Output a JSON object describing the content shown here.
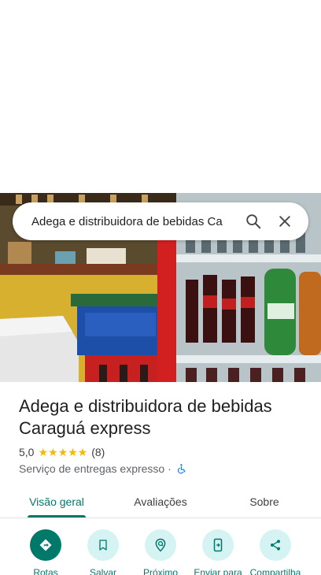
{
  "search": {
    "query": "Adega e distribuidora de bebidas Ca",
    "search_icon": "search-icon",
    "close_icon": "close-icon"
  },
  "place": {
    "name": "Adega e distribuidora de bebidas Caraguá express",
    "rating": "5,0",
    "stars": "★★★★★",
    "reviews_count": "(8)",
    "category": "Serviço de entregas expresso ·",
    "accessibility_icon": "wheelchair-icon"
  },
  "tabs": [
    {
      "label": "Visão geral",
      "active": true
    },
    {
      "label": "Avaliações",
      "active": false
    },
    {
      "label": "Sobre",
      "active": false
    }
  ],
  "actions": [
    {
      "label": "Rotas",
      "icon": "directions-icon"
    },
    {
      "label": "Salvar",
      "icon": "bookmark-icon"
    },
    {
      "label": "Próximo",
      "icon": "nearby-icon"
    },
    {
      "label": "Enviar para",
      "icon": "send-to-phone-icon"
    },
    {
      "label": "Compartilha",
      "icon": "share-icon"
    }
  ],
  "colors": {
    "accent": "#00796b",
    "action_bg": "#d6f3f3",
    "star": "#f6b800"
  }
}
